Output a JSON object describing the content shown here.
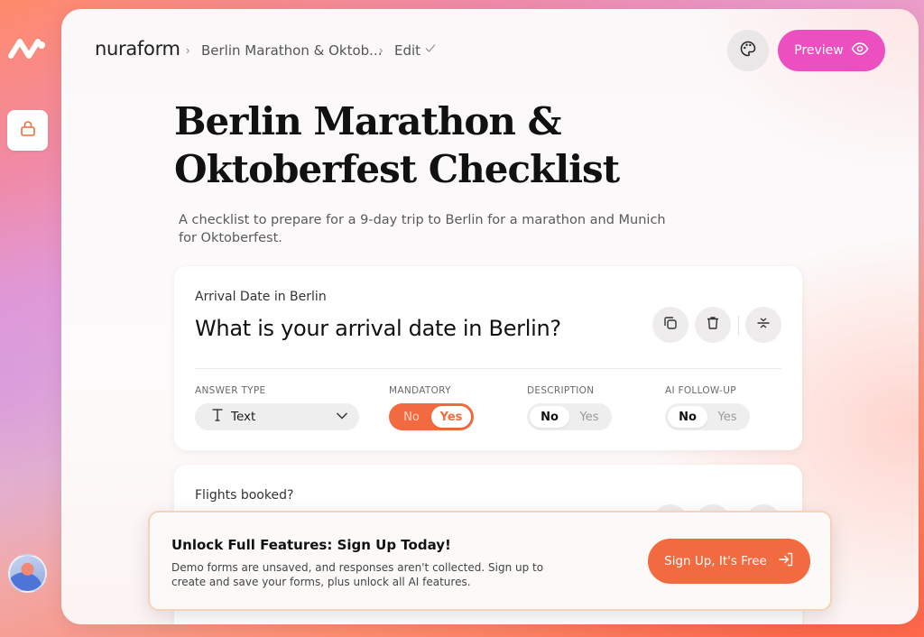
{
  "app": {
    "brand": "nuraform"
  },
  "breadcrumb": {
    "form": "Berlin Marathon & Oktob...",
    "mode": "Edit"
  },
  "header": {
    "preview_label": "Preview"
  },
  "form": {
    "title": "Berlin Marathon & Oktoberfest Checklist",
    "description": "A checklist to prepare for a 9-day trip to Berlin for a marathon and Munich for Oktoberfest."
  },
  "questions": [
    {
      "label": "Arrival Date in Berlin",
      "question": "What is your arrival date in Berlin?",
      "answer_type_label": "ANSWER TYPE",
      "answer_type": "Text",
      "mandatory_label": "MANDATORY",
      "mandatory": {
        "no": "No",
        "yes": "Yes",
        "selected": "Yes"
      },
      "description_label": "DESCRIPTION",
      "description": {
        "no": "No",
        "yes": "Yes",
        "selected": "No"
      },
      "ai_label": "AI FOLLOW-UP",
      "ai_followup": {
        "no": "No",
        "yes": "Yes",
        "selected": "No"
      }
    },
    {
      "label": "Flights booked?"
    }
  ],
  "banner": {
    "title": "Unlock Full Features: Sign Up Today!",
    "text": "Demo forms are unsaved, and responses aren't collected. Sign up to create and save your forms, plus unlock all AI features.",
    "button": "Sign Up, It's Free"
  },
  "colors": {
    "accent_orange": "#f26a3f",
    "preview_pink": "#ec4fbf"
  },
  "icons": [
    "nuraform-logo-icon",
    "lock-icon",
    "palette-icon",
    "eye-icon",
    "check-icon",
    "copy-icon",
    "trash-icon",
    "collapse-icon",
    "text-type-icon",
    "chevron-down-icon",
    "sign-in-icon"
  ]
}
